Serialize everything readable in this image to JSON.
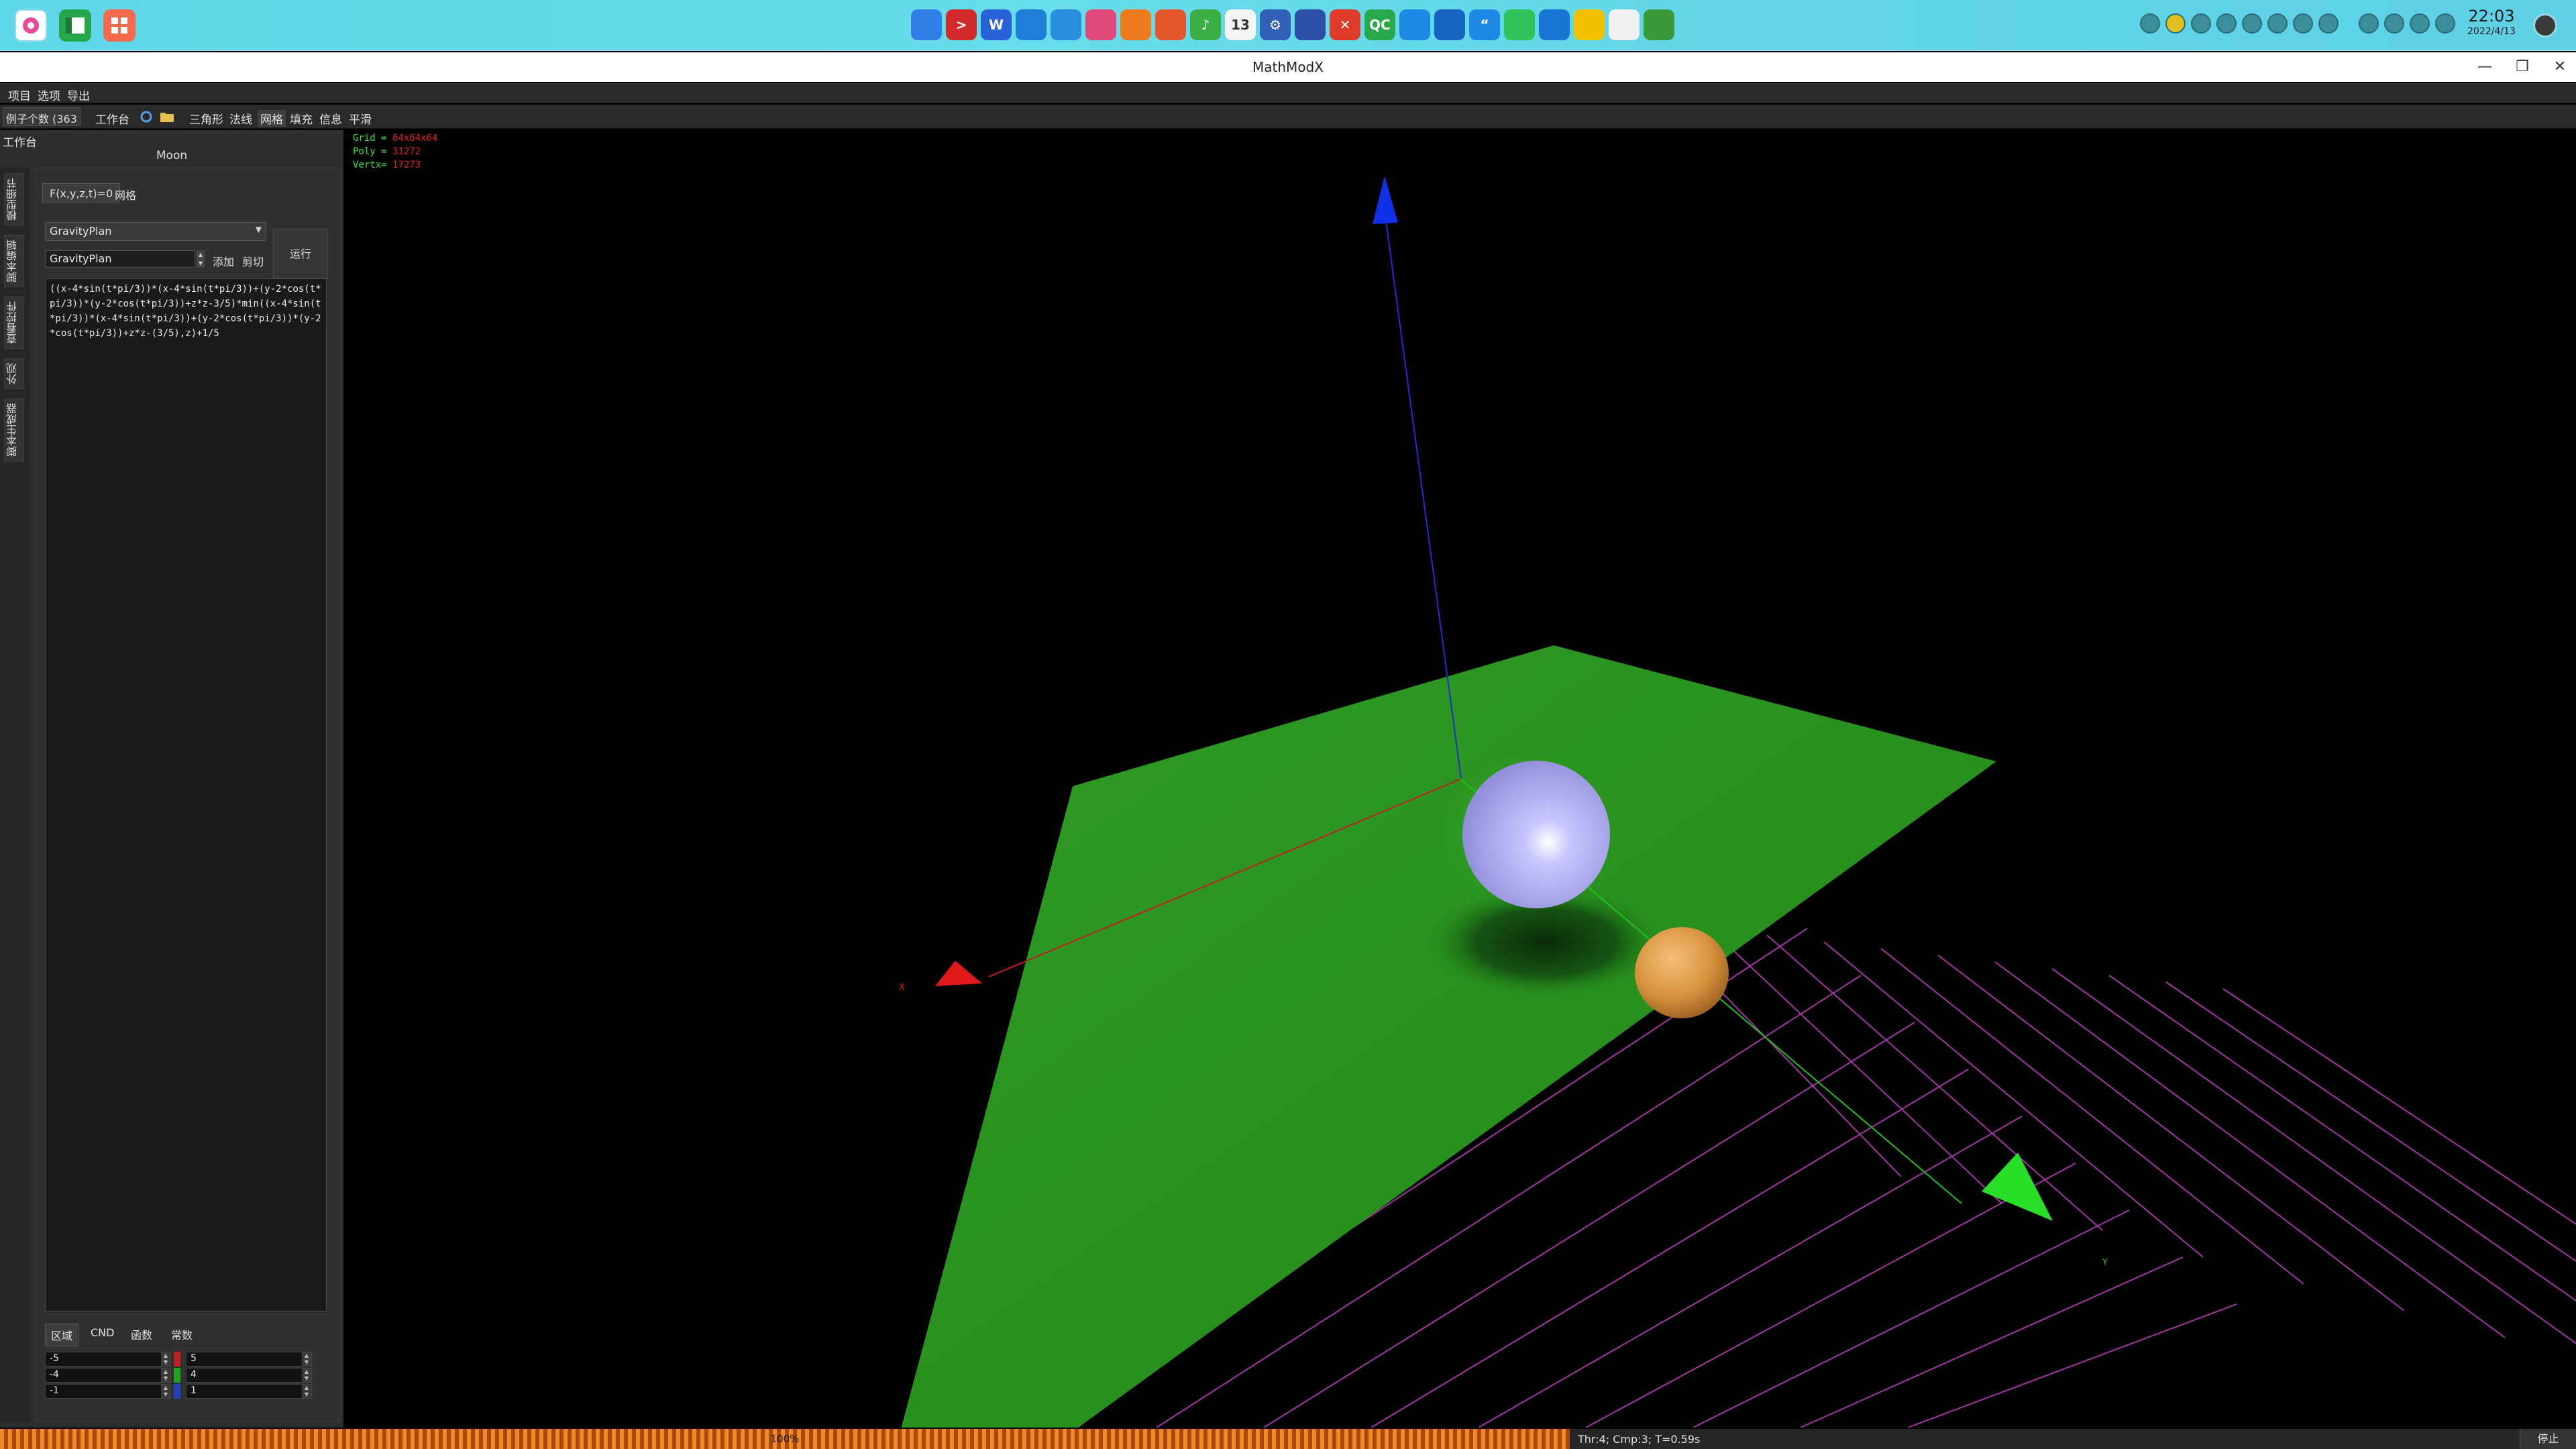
{
  "window": {
    "title": "MathModX",
    "minimize": "—",
    "restore": "❐",
    "close": "✕"
  },
  "clock": {
    "time": "22:03",
    "date": "2022/4/13"
  },
  "taskbar": {
    "left_apps": [
      "control-center-icon",
      "spreadsheet-icon",
      "launcher-icon"
    ],
    "pinned": [
      {
        "name": "store-icon",
        "color": "#2f7fe6",
        "glyph": ""
      },
      {
        "name": "terminal-icon",
        "color": "#d22a2a",
        "glyph": ">"
      },
      {
        "name": "wps-icon",
        "color": "#2a62d8",
        "glyph": "W"
      },
      {
        "name": "edge-icon",
        "color": "#1f7fd6",
        "glyph": ""
      },
      {
        "name": "browser-icon",
        "color": "#2b8fe0",
        "glyph": ""
      },
      {
        "name": "video-icon",
        "color": "#e04a7a",
        "glyph": ""
      },
      {
        "name": "app-store-icon",
        "color": "#f07a1e",
        "glyph": ""
      },
      {
        "name": "photo-icon",
        "color": "#e4572e",
        "glyph": ""
      },
      {
        "name": "music-icon",
        "color": "#3cae46",
        "glyph": "♪"
      },
      {
        "name": "calendar-icon",
        "color": "#f4f4f4",
        "glyph": "13"
      },
      {
        "name": "settings-icon",
        "color": "#3060b8",
        "glyph": "⚙"
      },
      {
        "name": "app-icon",
        "color": "#2e4fa8",
        "glyph": ""
      },
      {
        "name": "xmind-icon",
        "color": "#e03a2a",
        "glyph": "✕"
      },
      {
        "name": "qc-icon",
        "color": "#27a84a",
        "glyph": "QC"
      },
      {
        "name": "files-icon",
        "color": "#1e88e5",
        "glyph": ""
      },
      {
        "name": "cloud-icon",
        "color": "#1565c0",
        "glyph": ""
      },
      {
        "name": "notes-icon",
        "color": "#1e88e5",
        "glyph": "“"
      },
      {
        "name": "wechat-icon",
        "color": "#2ec45a",
        "glyph": ""
      },
      {
        "name": "mail-icon",
        "color": "#1976d2",
        "glyph": ""
      },
      {
        "name": "pika-icon",
        "color": "#f2c200",
        "glyph": ""
      },
      {
        "name": "pet-icon",
        "color": "#f0f0f0",
        "glyph": ""
      },
      {
        "name": "tree-icon",
        "color": "#3a9a3a",
        "glyph": ""
      }
    ]
  },
  "menubar": {
    "items": [
      "项目",
      "选项",
      "导出"
    ]
  },
  "toolbar": {
    "example_count": "例子个数 (363",
    "workbench": "工作台",
    "triangle": "三角形",
    "normals": "法线",
    "mesh": "网格",
    "fill": "填充",
    "info": "信息",
    "smooth": "平滑"
  },
  "dock": {
    "title": "工作台",
    "model_name": "Moon",
    "vtabs": [
      "模型细节",
      "脚本编辑",
      "查看控件",
      "外观",
      "脚本生成器"
    ],
    "tabs": [
      "F(x,y,z,t)=0",
      "网格"
    ],
    "script_select": "GravityPlan",
    "name_field": "GravityPlan",
    "add": "添加",
    "cut": "剪切",
    "run": "运行",
    "formula": "((x-4*sin(t*pi/3))*(x-4*sin(t*pi/3))+(y-2*cos(t*pi/3))*(y-2*cos(t*pi/3))+z*z-3/5)*min((x-4*sin(t*pi/3))*(x-4*sin(t*pi/3))+(y-2*cos(t*pi/3))*(y-2*cos(t*pi/3))+z*z-(3/5),z)+1/5",
    "bottom_tabs": [
      "区域",
      "CND",
      "函数",
      "常数"
    ],
    "ranges_min": [
      "-5",
      "-4",
      "-1"
    ],
    "ranges_max": [
      "5",
      "4",
      "1"
    ],
    "range_colors": [
      "#c02020",
      "#20a020",
      "#2040c0"
    ]
  },
  "viewport": {
    "grid_label": "Grid =",
    "grid_value": "64x64x64",
    "poly_label": "Poly =",
    "poly_value": "31272",
    "vertx_label": "Vertx=",
    "vertx_value": "17273",
    "axis_x": "X",
    "axis_y": "Y",
    "plane_color": "#2a9a1e",
    "sphere_color": "#b7b4f0",
    "moon_color": "#e0a050",
    "grid_color": "#c040c0"
  },
  "status": {
    "progress_percent": 100,
    "progress_text": "100%",
    "text": "Thr:4; Cmp:3; T=0.59s",
    "stop": "停止"
  }
}
